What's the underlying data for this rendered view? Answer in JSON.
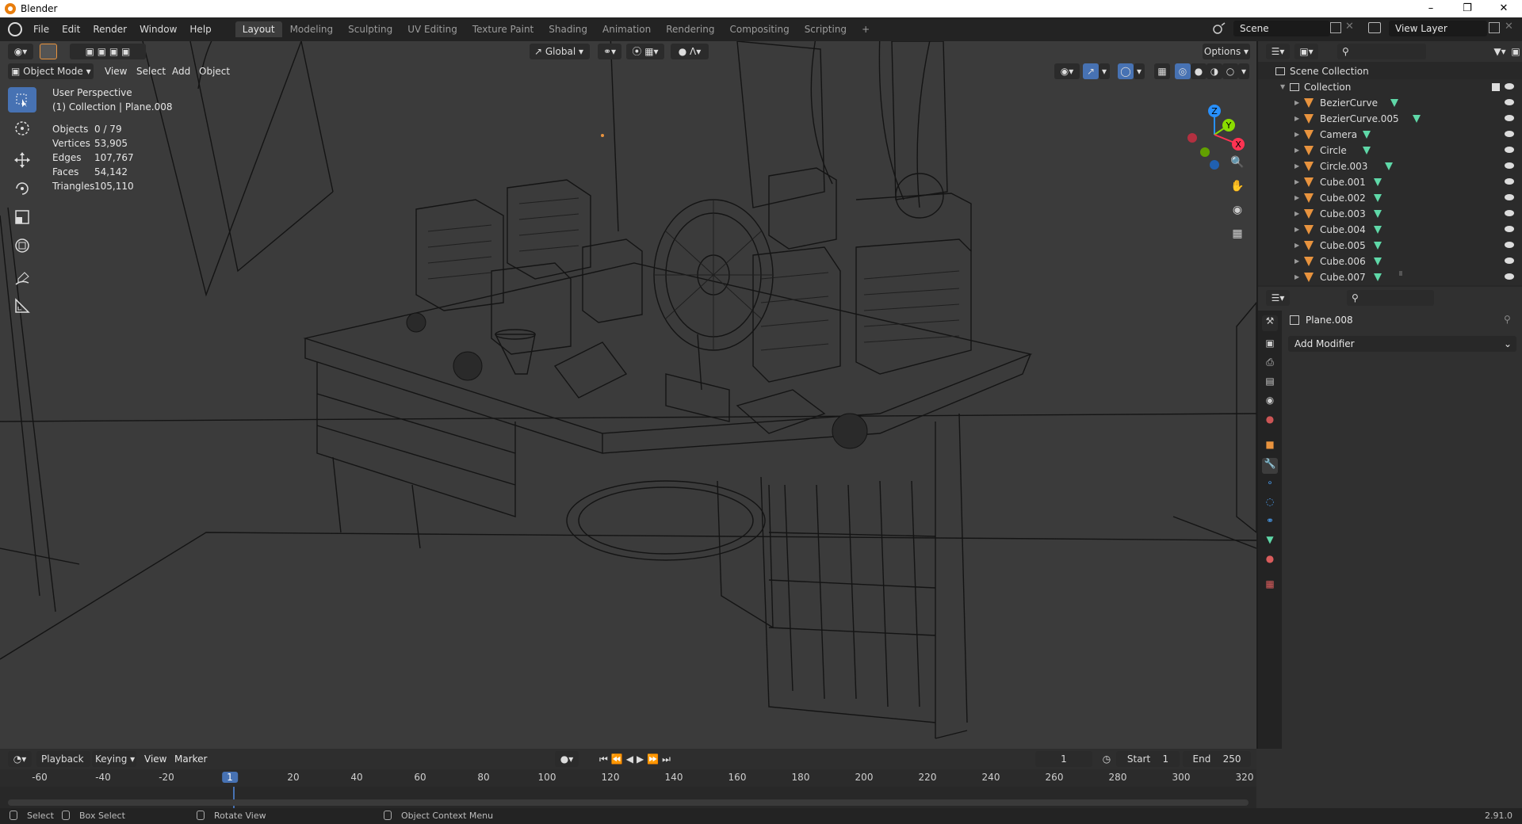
{
  "window": {
    "title": "Blender",
    "controls": [
      "minimize",
      "restore",
      "close"
    ]
  },
  "menu": [
    "File",
    "Edit",
    "Render",
    "Window",
    "Help"
  ],
  "workspaces": [
    {
      "label": "Layout",
      "active": true
    },
    {
      "label": "Modeling"
    },
    {
      "label": "Sculpting"
    },
    {
      "label": "UV Editing"
    },
    {
      "label": "Texture Paint"
    },
    {
      "label": "Shading"
    },
    {
      "label": "Animation"
    },
    {
      "label": "Rendering"
    },
    {
      "label": "Compositing"
    },
    {
      "label": "Scripting"
    }
  ],
  "add_workspace": "+",
  "scene": {
    "name": "Scene",
    "view_layer": "View Layer"
  },
  "viewport": {
    "transform_orientation": "Global",
    "options_label": "Options",
    "mode": "Object Mode",
    "menus": [
      "View",
      "Select",
      "Add",
      "Object"
    ],
    "perspective": "User Perspective",
    "active": "(1) Collection | Plane.008",
    "stats": [
      {
        "k": "Objects",
        "v": "0 / 79"
      },
      {
        "k": "Vertices",
        "v": "53,905"
      },
      {
        "k": "Edges",
        "v": "107,767"
      },
      {
        "k": "Faces",
        "v": "54,142"
      },
      {
        "k": "Triangles",
        "v": "105,110"
      }
    ],
    "gizmo": {
      "z": "Z",
      "y": "Y",
      "x": "X"
    }
  },
  "outliner": {
    "root": "Scene Collection",
    "collection": "Collection",
    "items": [
      {
        "name": "BezierCurve",
        "type": "curve"
      },
      {
        "name": "BezierCurve.005",
        "type": "curve"
      },
      {
        "name": "Camera",
        "type": "camera"
      },
      {
        "name": "Circle",
        "type": "curve"
      },
      {
        "name": "Circle.003",
        "type": "mesh"
      },
      {
        "name": "Cube.001",
        "type": "mesh"
      },
      {
        "name": "Cube.002",
        "type": "mesh"
      },
      {
        "name": "Cube.003",
        "type": "mesh"
      },
      {
        "name": "Cube.004",
        "type": "mesh"
      },
      {
        "name": "Cube.005",
        "type": "mesh"
      },
      {
        "name": "Cube.006",
        "type": "mesh"
      },
      {
        "name": "Cube.007",
        "type": "mesh"
      }
    ]
  },
  "properties": {
    "object_name": "Plane.008",
    "add_modifier": "Add Modifier"
  },
  "timeline": {
    "menus": [
      "Playback",
      "Keying",
      "View",
      "Marker"
    ],
    "current_frame": "1",
    "start_label": "Start",
    "start": "1",
    "end_label": "End",
    "end": "250",
    "ticks": [
      "-60",
      "-40",
      "-20",
      "1",
      "20",
      "40",
      "60",
      "80",
      "100",
      "120",
      "140",
      "160",
      "180",
      "200",
      "220",
      "240",
      "260",
      "280",
      "300",
      "320"
    ]
  },
  "status": {
    "select": "Select",
    "box_select": "Box Select",
    "rotate": "Rotate View",
    "context": "Object Context Menu",
    "version": "2.91.0"
  },
  "colors": {
    "accent": "#4772b3",
    "object": "#e8933e",
    "mesh": "#5fd8a8",
    "axis_x": "#ff3352",
    "axis_y": "#8bdc00",
    "axis_z": "#2890ff"
  }
}
